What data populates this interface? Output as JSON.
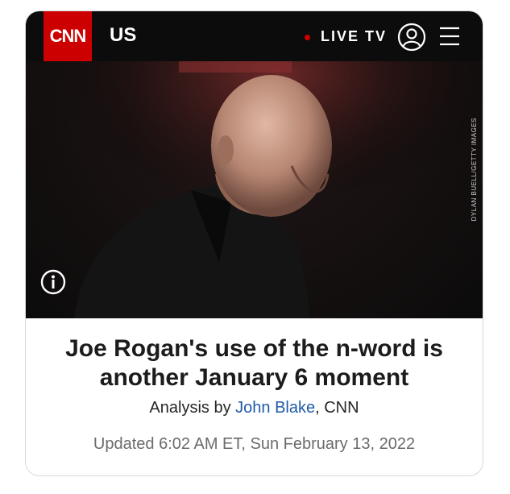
{
  "nav": {
    "logo_text": "CNN",
    "section": "US",
    "live_label": "LIVE TV",
    "live_dot_color": "#cc0000",
    "user_icon": "user-circle-icon",
    "menu_icon": "hamburger-menu-icon"
  },
  "hero": {
    "photo_credit": "DYLAN BUELL/GETTY IMAGES",
    "info_icon": "info-icon"
  },
  "article": {
    "headline": "Joe Rogan's use of the n-word is another January 6 moment",
    "byline_prefix": "Analysis by ",
    "author": "John Blake",
    "byline_suffix": ", CNN",
    "updated": "Updated 6:02 AM ET, Sun February 13, 2022"
  },
  "colors": {
    "brand_red": "#cc0000",
    "nav_bg": "#0c0c0c",
    "link_blue": "#1f5aa8"
  }
}
